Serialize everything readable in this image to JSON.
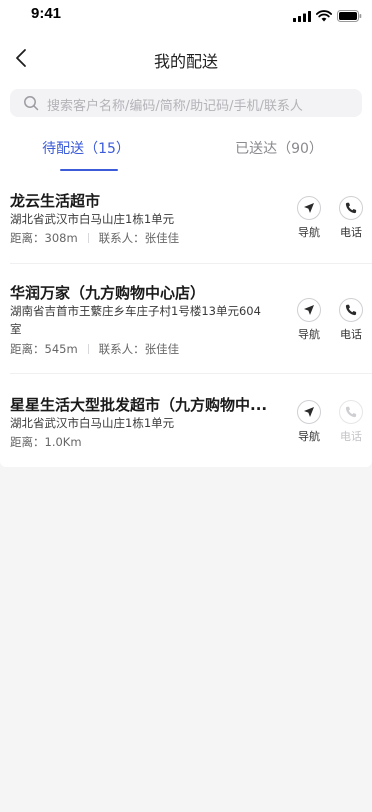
{
  "status_bar": {
    "time": "9:41"
  },
  "header": {
    "title": "我的配送"
  },
  "search": {
    "placeholder": "搜索客户名称/编码/简称/助记码/手机/联系人"
  },
  "tabs": [
    {
      "label": "待配送（15）",
      "active": true
    },
    {
      "label": "已送达（90）",
      "active": false
    }
  ],
  "colors": {
    "accent": "#3b5bd9",
    "background": "#f5f5f6"
  },
  "deliveries": [
    {
      "name": "龙云生活超市",
      "address": "湖北省武汉市白马山庄1栋1单元",
      "distance_label": "距离：308m",
      "contact_label": "联系人：张佳佳",
      "navigate_label": "导航",
      "call_label": "电话",
      "call_enabled": true
    },
    {
      "name": "华润万家（九方购物中心店）",
      "address": "湖南省吉首市王蘩庄乡车庄子村1号楼13单元604室",
      "distance_label": "距离：545m",
      "contact_label": "联系人：张佳佳",
      "navigate_label": "导航",
      "call_label": "电话",
      "call_enabled": true
    },
    {
      "name": "星星生活大型批发超市（九方购物中...",
      "address": "湖北省武汉市白马山庄1栋1单元",
      "distance_label": "距离：1.0Km",
      "contact_label": "",
      "navigate_label": "导航",
      "call_label": "电话",
      "call_enabled": false
    }
  ]
}
